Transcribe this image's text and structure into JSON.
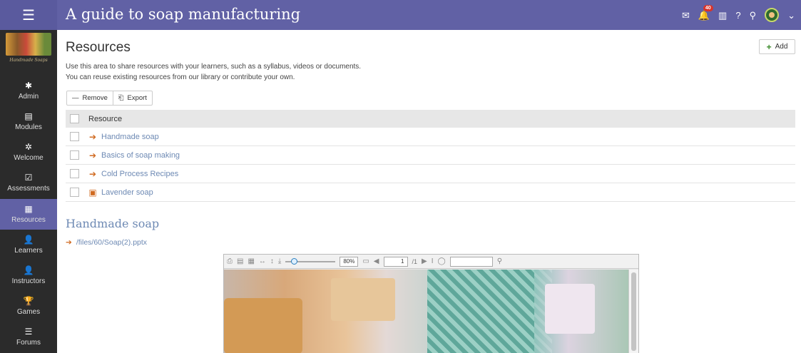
{
  "topbar": {
    "menu_icon": "hamburger-icon",
    "title": "A guide to soap manufacturing",
    "icons": [
      "mail-icon",
      "notifications-icon",
      "trash-icon",
      "help-icon",
      "search-icon",
      "avatar",
      "chevron-down-icon"
    ],
    "notification_count": "40",
    "color": "#6161a5"
  },
  "sidebar": {
    "logo_text": "Handmade Soaps",
    "items": [
      {
        "label": "Admin",
        "icon": "gear-icon"
      },
      {
        "label": "Modules",
        "icon": "modules-icon"
      },
      {
        "label": "Welcome",
        "icon": "welcome-icon"
      },
      {
        "label": "Assessments",
        "icon": "checkbox-icon"
      },
      {
        "label": "Resources",
        "icon": "resources-icon",
        "active": true
      },
      {
        "label": "Learners",
        "icon": "person-icon"
      },
      {
        "label": "Instructors",
        "icon": "instructor-icon"
      },
      {
        "label": "Games",
        "icon": "trophy-icon"
      },
      {
        "label": "Forums",
        "icon": "forum-icon"
      }
    ]
  },
  "main": {
    "title": "Resources",
    "add_label": "Add",
    "intro_line1": "Use this area to share resources with your learners, such as a syllabus, videos or documents.",
    "intro_line2": "You can reuse existing resources from our library or contribute your own.",
    "toolbar": {
      "remove_label": "Remove",
      "export_label": "Export"
    },
    "table": {
      "header": "Resource",
      "rows": [
        {
          "label": "Handmade soap",
          "icon": "arrow-right-icon"
        },
        {
          "label": "Basics of soap making",
          "icon": "arrow-right-icon"
        },
        {
          "label": "Cold Process Recipes",
          "icon": "arrow-right-icon"
        },
        {
          "label": "Lavender soap",
          "icon": "film-icon"
        }
      ]
    },
    "section_title": "Handmade soap",
    "file_path": "/files/60/Soap(2).pptx"
  },
  "viewer": {
    "zoom": "80%",
    "page": "1",
    "page_total": "/1",
    "search_value": ""
  }
}
